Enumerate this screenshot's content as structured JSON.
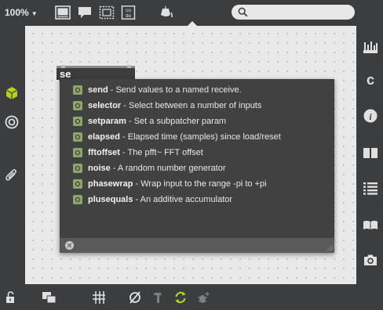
{
  "toolbar": {
    "zoom_label": "100%",
    "icons": [
      "presentation-icon",
      "comment-icon",
      "fullscreen-icon",
      "code-icon",
      "paint-bucket-icon"
    ],
    "code_icon_text": "co de",
    "search": {
      "value": "",
      "placeholder": ""
    }
  },
  "object_box": {
    "text": "se"
  },
  "autocomplete": {
    "items": [
      {
        "name": "send",
        "description": " - Send values to a named receive."
      },
      {
        "name": "selector",
        "description": " - Select between a number of inputs"
      },
      {
        "name": "setparam",
        "description": " - Set a subpatcher param"
      },
      {
        "name": "elapsed",
        "description": " - Elapsed time (samples) since load/reset"
      },
      {
        "name": "fftoffset",
        "description": " - The pfft~ FFT offset"
      },
      {
        "name": "noise",
        "description": " - A random number generator"
      },
      {
        "name": "phasewrap",
        "description": " - Wrap input to the range -pi to +pi"
      },
      {
        "name": "plusequals",
        "description": " - An additive accumulator"
      }
    ]
  },
  "left_sidebar": {
    "icons": [
      "cube-icon",
      "target-icon",
      "paperclip-icon"
    ]
  },
  "right_sidebar": {
    "icons": [
      "mixer-icon",
      "c-letter-icon",
      "info-icon",
      "book-open-icon",
      "list-icon",
      "reference-book-icon",
      "camera-icon"
    ]
  },
  "bottom_bar": {
    "icons": [
      "lock-icon",
      "windows-icon",
      "grid-icon",
      "null-icon",
      "hammer-icon",
      "refresh-icon",
      "debug-icon"
    ]
  },
  "colors": {
    "chrome": "#3b3d3f",
    "canvas": "#e9e9e9",
    "popup": "#414142",
    "object_icon": "#8ea56a",
    "accent_green": "#b5d11e"
  }
}
